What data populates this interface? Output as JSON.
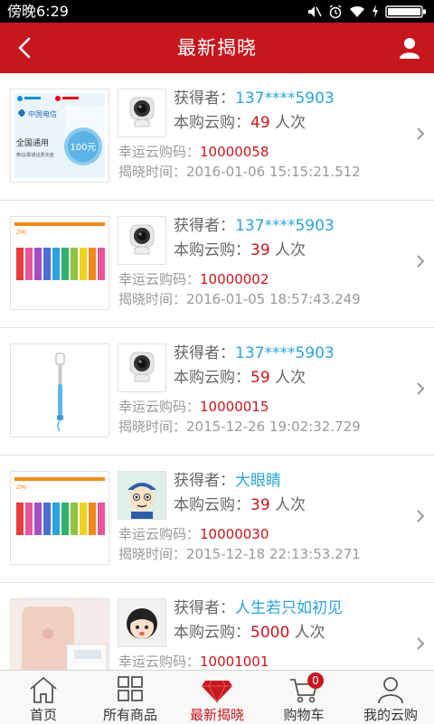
{
  "status_bar": {
    "time": "傍晚6:29"
  },
  "header": {
    "title": "最新揭晓"
  },
  "labels": {
    "winner": "获得者：",
    "purchase": "本购云购：",
    "purchase_unit": " 人次",
    "lucky_code": "幸运云购码：",
    "reveal_time": "揭晓时间："
  },
  "items": [
    {
      "product": "china-telecom-recharge-card",
      "card_text": "全国通用",
      "card_value": "100元",
      "card_sub": "移动/联通话费充值",
      "avatar": "camera",
      "winner": "137****5903",
      "purchase_count": "49",
      "lucky_code": "10000058",
      "reveal_time": "2016-01-06 15:15:21.512"
    },
    {
      "product": "battery-pack",
      "pack_brand": "ZMI",
      "avatar": "camera",
      "winner": "137****5903",
      "purchase_count": "39",
      "lucky_code": "10000002",
      "reveal_time": "2016-01-05 18:57:43.249"
    },
    {
      "product": "selfie-stick",
      "avatar": "camera",
      "winner": "137****5903",
      "purchase_count": "59",
      "lucky_code": "10000015",
      "reveal_time": "2015-12-26 19:02:32.729"
    },
    {
      "product": "battery-pack",
      "pack_brand": "ZMI",
      "avatar": "cartoon-boy",
      "winner": "大眼睛",
      "purchase_count": "39",
      "lucky_code": "10000030",
      "reveal_time": "2015-12-18 22:13:53.271"
    },
    {
      "product": "iphone-rose-gold",
      "avatar": "cartoon-girl",
      "winner": "人生若只如初见",
      "purchase_count": "5000",
      "lucky_code": "10001001",
      "reveal_time": ""
    }
  ],
  "bottom_nav": [
    {
      "label": "首页",
      "icon": "home-icon",
      "active": false
    },
    {
      "label": "所有商品",
      "icon": "grid-icon",
      "active": false
    },
    {
      "label": "最新揭晓",
      "icon": "gem-icon",
      "active": true
    },
    {
      "label": "购物车",
      "icon": "cart-icon",
      "active": false,
      "badge": "0"
    },
    {
      "label": "我的云购",
      "icon": "person-icon",
      "active": false
    }
  ],
  "colors": {
    "brand_red": "#c6171e",
    "accent_blue": "#2aa4dd",
    "value_red": "#c8161e"
  }
}
